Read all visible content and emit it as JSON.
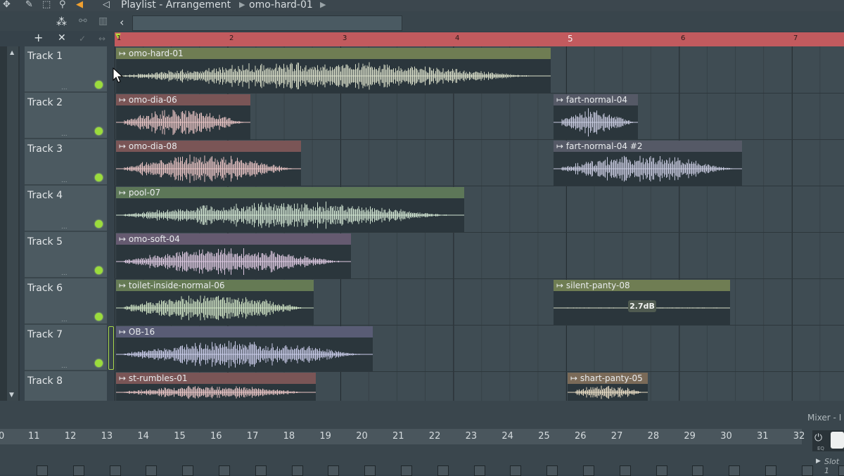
{
  "window": {
    "title_crumb": "Playlist - Arrangement",
    "pattern_crumb": "omo-hard-01"
  },
  "toolbar": {
    "add_symbol": "+",
    "delete_symbol": "✕",
    "back_arrow": "‹"
  },
  "timeline": {
    "bars": [
      "1",
      "2",
      "3",
      "4",
      "5",
      "6",
      "7"
    ]
  },
  "tracks": [
    {
      "name": "Track 1"
    },
    {
      "name": "Track 2"
    },
    {
      "name": "Track 3"
    },
    {
      "name": "Track 4"
    },
    {
      "name": "Track 5"
    },
    {
      "name": "Track 6"
    },
    {
      "name": "Track 7"
    },
    {
      "name": "Track 8"
    }
  ],
  "clips": [
    {
      "label": "omo-hard-01",
      "color": "#6f7d53"
    },
    {
      "label": "omo-dia-06",
      "color": "#7a5556"
    },
    {
      "label": "fart-normal-04",
      "color": "#555966"
    },
    {
      "label": "omo-dia-08",
      "color": "#7a5556"
    },
    {
      "label": "fart-normal-04 #2",
      "color": "#555966"
    },
    {
      "label": "pool-07",
      "color": "#5d7758"
    },
    {
      "label": "omo-soft-04",
      "color": "#655a70"
    },
    {
      "label": "toilet-inside-normal-06",
      "color": "#657a54"
    },
    {
      "label": "silent-panty-08",
      "color": "#6f7d53"
    },
    {
      "label": "OB-16",
      "color": "#595c75"
    },
    {
      "label": "st-rumbles-01",
      "color": "#7a5556"
    },
    {
      "label": "shart-panty-05",
      "color": "#7a6a58"
    }
  ],
  "volume_badge": "2.7dB",
  "bottom_ruler": [
    "0",
    "11",
    "12",
    "13",
    "14",
    "15",
    "16",
    "17",
    "18",
    "19",
    "20",
    "21",
    "22",
    "23",
    "24",
    "25",
    "26",
    "27",
    "28",
    "29",
    "30",
    "31",
    "32"
  ],
  "mixer_label": "Mixer - I",
  "side_panel": {
    "slot_label": "Slot 1",
    "eq_label": "EQ"
  }
}
